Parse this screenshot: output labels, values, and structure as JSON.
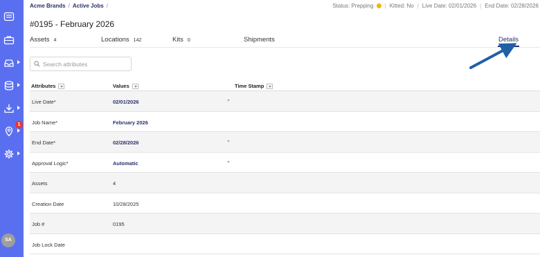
{
  "breadcrumb": {
    "root": "Acme Brands",
    "section": "Active Jobs"
  },
  "status": {
    "status_text": "Status: Prepping",
    "kitted_text": "Kitted: No",
    "live_date_text": "Live Date: 02/01/2026",
    "end_date_text": "End Date: 02/28/2026",
    "status_color": "#f4b400"
  },
  "page_title": "#0195 - February 2026",
  "tabs": [
    {
      "label": "Assets",
      "count": "4"
    },
    {
      "label": "Locations",
      "count": "142"
    },
    {
      "label": "Kits",
      "count": "0"
    },
    {
      "label": "Shipments",
      "count": ""
    },
    {
      "label": "Details",
      "count": ""
    }
  ],
  "active_tab": "Details",
  "search": {
    "placeholder": "Search attributes"
  },
  "columns": {
    "attributes": "Attributes",
    "values": "Values",
    "timestamp": "Time Stamp"
  },
  "rows": [
    {
      "attribute": "Live Date*",
      "value": "02/01/2026"
    },
    {
      "attribute": "Job Name*",
      "value": "February 2026"
    },
    {
      "attribute": "End Date*",
      "value": "02/28/2026"
    },
    {
      "attribute": "Approval Logic*",
      "value": "Automatic"
    },
    {
      "attribute": "Assets",
      "value": "4"
    },
    {
      "attribute": "Creation Date",
      "value": "10/28/2025"
    },
    {
      "attribute": "Job #",
      "value": "0195"
    },
    {
      "attribute": "Job Lock Date",
      "value": ""
    }
  ],
  "sidebar": {
    "notification_count": "1",
    "avatar_initials": "SA"
  },
  "colors": {
    "sidebar": "#5a6ff0",
    "accent": "#2a2f6b",
    "badge": "#e53935",
    "arrow": "#1f5fa8"
  }
}
